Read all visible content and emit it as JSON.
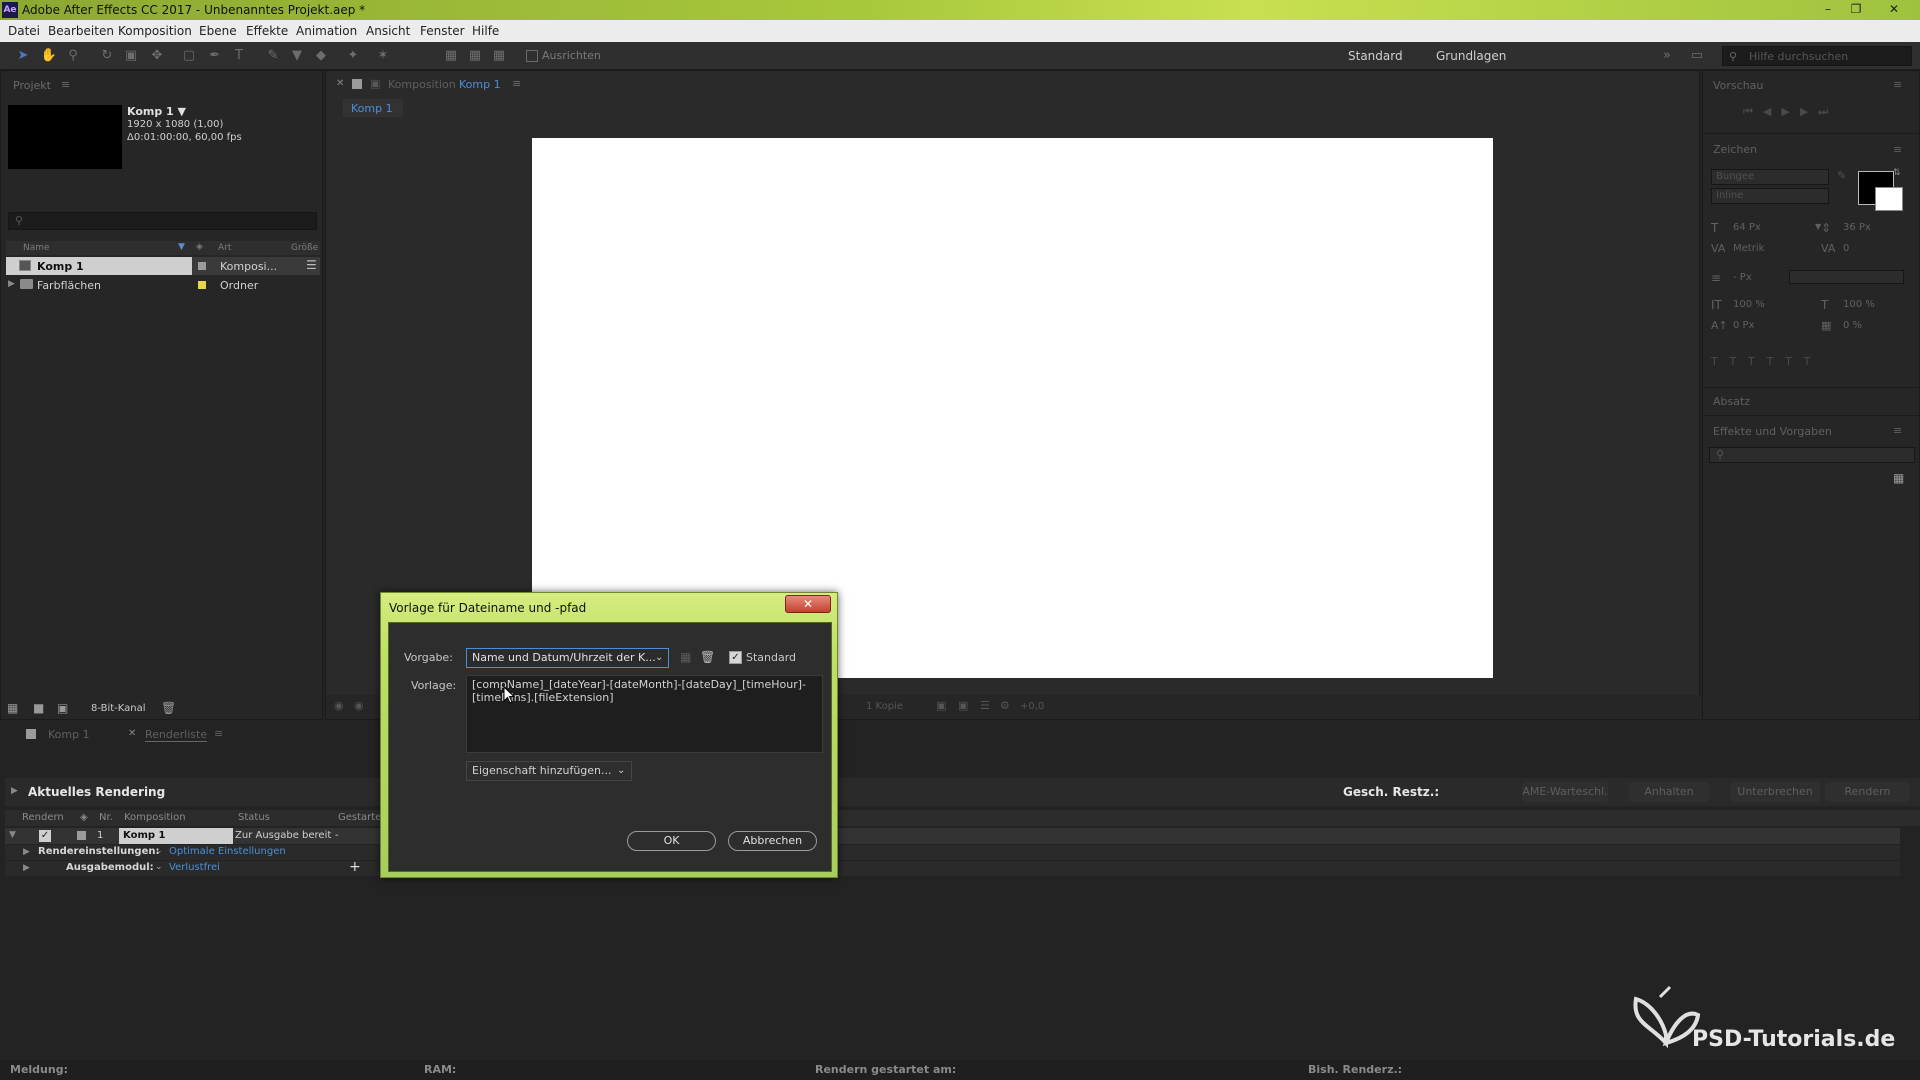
{
  "window": {
    "title": "Adobe After Effects CC 2017 - Unbenanntes Projekt.aep *",
    "app_badge": "Ae"
  },
  "menu": [
    "Datei",
    "Bearbeiten",
    "Komposition",
    "Ebene",
    "Effekte",
    "Animation",
    "Ansicht",
    "Fenster",
    "Hilfe"
  ],
  "toolbar": {
    "snap_label": "Ausrichten",
    "workspace_standard": "Standard",
    "workspace_basics": "Grundlagen",
    "help_search": "Hilfe durchsuchen"
  },
  "project": {
    "panel_title": "Projekt",
    "comp_name": "Komp 1 ▼",
    "comp_size": "1920 x 1080 (1,00)",
    "comp_duration": "Δ0:01:00:00, 60,00 fps",
    "columns": {
      "name": "Name",
      "type": "Art",
      "size": "Größe"
    },
    "items": [
      {
        "name": "Komp 1",
        "type": "Komposi...",
        "label_color": "#9b9b9b"
      },
      {
        "name": "Farbflächen",
        "type": "Ordner",
        "label_color": "#e8d34a"
      }
    ],
    "bit_depth": "8-Bit-Kanal"
  },
  "composition": {
    "panel_label": "Komposition",
    "panel_comp": "Komp 1",
    "tab": "Komp 1",
    "zoom": "1 Kopie",
    "exposure": "+0,0"
  },
  "right_panels": {
    "preview": "Vorschau",
    "character": "Zeichen",
    "font": "Bungee",
    "style": "Inline",
    "font_size": "64 Px",
    "leading": "36 Px",
    "kerning": "Metrik",
    "tracking": "0",
    "stroke": "- Px",
    "vscale": "100 %",
    "hscale": "100 %",
    "baseline": "0 Px",
    "tsume": "0 %",
    "paragraph": "Absatz",
    "effects": "Effekte und Vorgaben"
  },
  "render_queue": {
    "tab_comp": "Komp 1",
    "tab_rq": "Renderliste",
    "current_rendering": "Aktuelles Rendering",
    "remaining": "Gesch. Restz.:",
    "buttons": [
      "AME-Warteschl.",
      "Anhalten",
      "Unterbrechen",
      "Rendern"
    ],
    "columns": {
      "render": "Rendern",
      "nr": "Nr.",
      "comp": "Komposition",
      "status": "Status",
      "started": "Gestartet"
    },
    "item": {
      "nr": "1",
      "comp": "Komp 1",
      "status": "Zur Ausgabe bereit",
      "started": "-"
    },
    "render_settings_label": "Rendereinstellungen:",
    "render_settings_value": "Optimale Einstellungen",
    "output_module_label": "Ausgabemodul:",
    "output_module_value": "Verlustfrei"
  },
  "dialog": {
    "title": "Vorlage für Dateiname und -pfad",
    "preset_label": "Vorgabe:",
    "preset_value": "Name und Datum/Uhrzeit der K...",
    "default_label": "Standard",
    "default_checked": true,
    "template_label": "Vorlage:",
    "template_value": "[compName]_[dateYear]-[dateMonth]-[dateDay]_[timeHour]-\n[timeMins].[fileExtension]",
    "add_property": "Eigenschaft hinzufügen...",
    "ok": "OK",
    "cancel": "Abbrechen"
  },
  "status_bar": {
    "message": "Meldung:",
    "ram": "RAM:",
    "render_started": "Rendern gestartet am:",
    "elapsed": "Bish. Renderz.:"
  },
  "watermark": {
    "text": "PSD-Tutorials.de"
  }
}
